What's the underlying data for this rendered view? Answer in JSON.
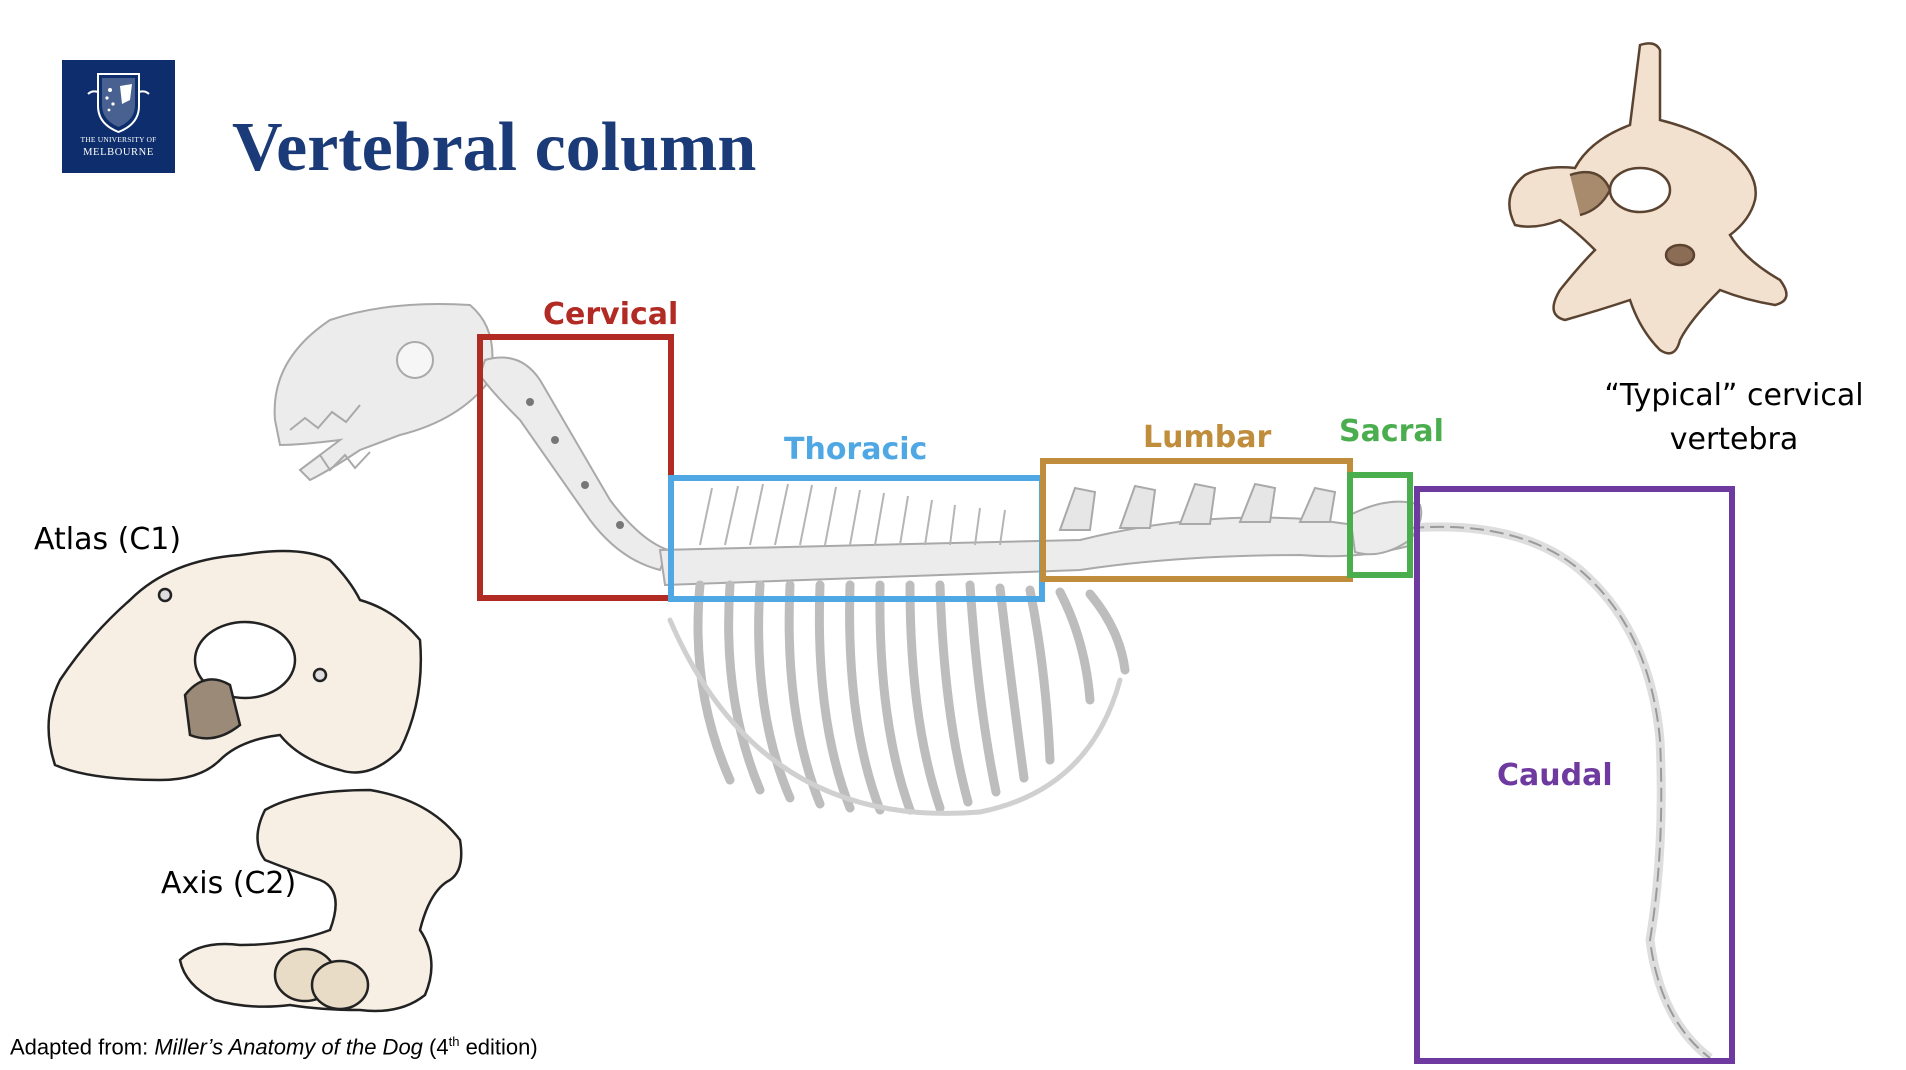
{
  "logo": {
    "line1": "THE UNIVERSITY OF",
    "line2": "MELBOURNE"
  },
  "title": "Vertebral column",
  "regions": [
    {
      "key": "cervical",
      "label": "Cervical",
      "color": "#b22a24"
    },
    {
      "key": "thoracic",
      "label": "Thoracic",
      "color": "#4fa8e3"
    },
    {
      "key": "lumbar",
      "label": "Lumbar",
      "color": "#c08d3d"
    },
    {
      "key": "sacral",
      "label": "Sacral",
      "color": "#4aad4e"
    },
    {
      "key": "caudal",
      "label": "Caudal",
      "color": "#6f3aa0"
    }
  ],
  "captions": {
    "atlas": "Atlas (C1)",
    "axis": "Axis (C2)",
    "typical": "“Typical” cervical vertebra"
  },
  "source": {
    "prefix": "Adapted from: ",
    "book": "Miller’s Anatomy of the Dog",
    "edition_open": " (4",
    "edition_sup": "th",
    "edition_close": " edition)"
  }
}
